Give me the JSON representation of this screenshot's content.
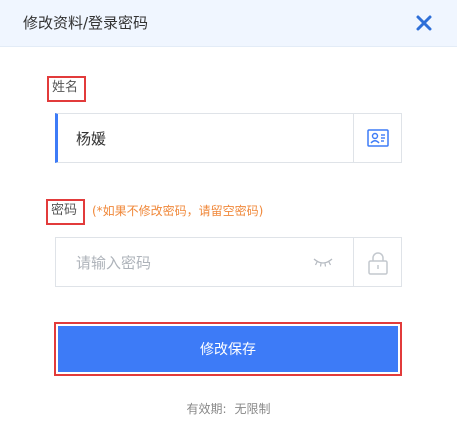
{
  "header": {
    "title": "修改资料/登录密码"
  },
  "name_field": {
    "label": "姓名",
    "value": "杨媛"
  },
  "password_field": {
    "label": "密码",
    "hint": "(*如果不修改密码，请留空密码)",
    "placeholder": "请输入密码"
  },
  "save_button": {
    "label": "修改保存"
  },
  "validity": {
    "label": "有效期:",
    "value": "无限制"
  },
  "colors": {
    "accent": "#3d7bf7",
    "highlight_border": "#e23b3b",
    "hint": "#f0883a",
    "header_bg": "#f0f6ff"
  }
}
